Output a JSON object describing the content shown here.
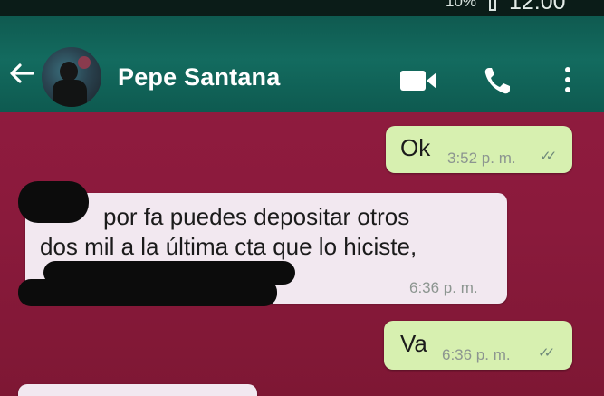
{
  "status_bar": {
    "battery": "10%",
    "clock": "12:00"
  },
  "header": {
    "contact_name": "Pepe Santana",
    "icons": {
      "back": "arrow-left",
      "avatar": "contact-photo",
      "video": "video-camera",
      "call": "phone",
      "menu": "more-vertical"
    }
  },
  "messages": [
    {
      "direction": "outgoing",
      "text": "Ok",
      "time": "3:52 p. m.",
      "status": "read"
    },
    {
      "direction": "incoming",
      "lines": [
        "por fa puedes depositar otros",
        "dos mil a la última cta que lo hiciste,"
      ],
      "redacted": true,
      "time": "6:36 p. m."
    },
    {
      "direction": "outgoing",
      "text": "Va",
      "time": "6:36 p. m.",
      "status": "read"
    }
  ],
  "colors": {
    "header": "#136b5f",
    "chat_background": "#8e1a3f",
    "outgoing_bubble": "#d7f0b0",
    "incoming_bubble": "#f2e8f0"
  }
}
